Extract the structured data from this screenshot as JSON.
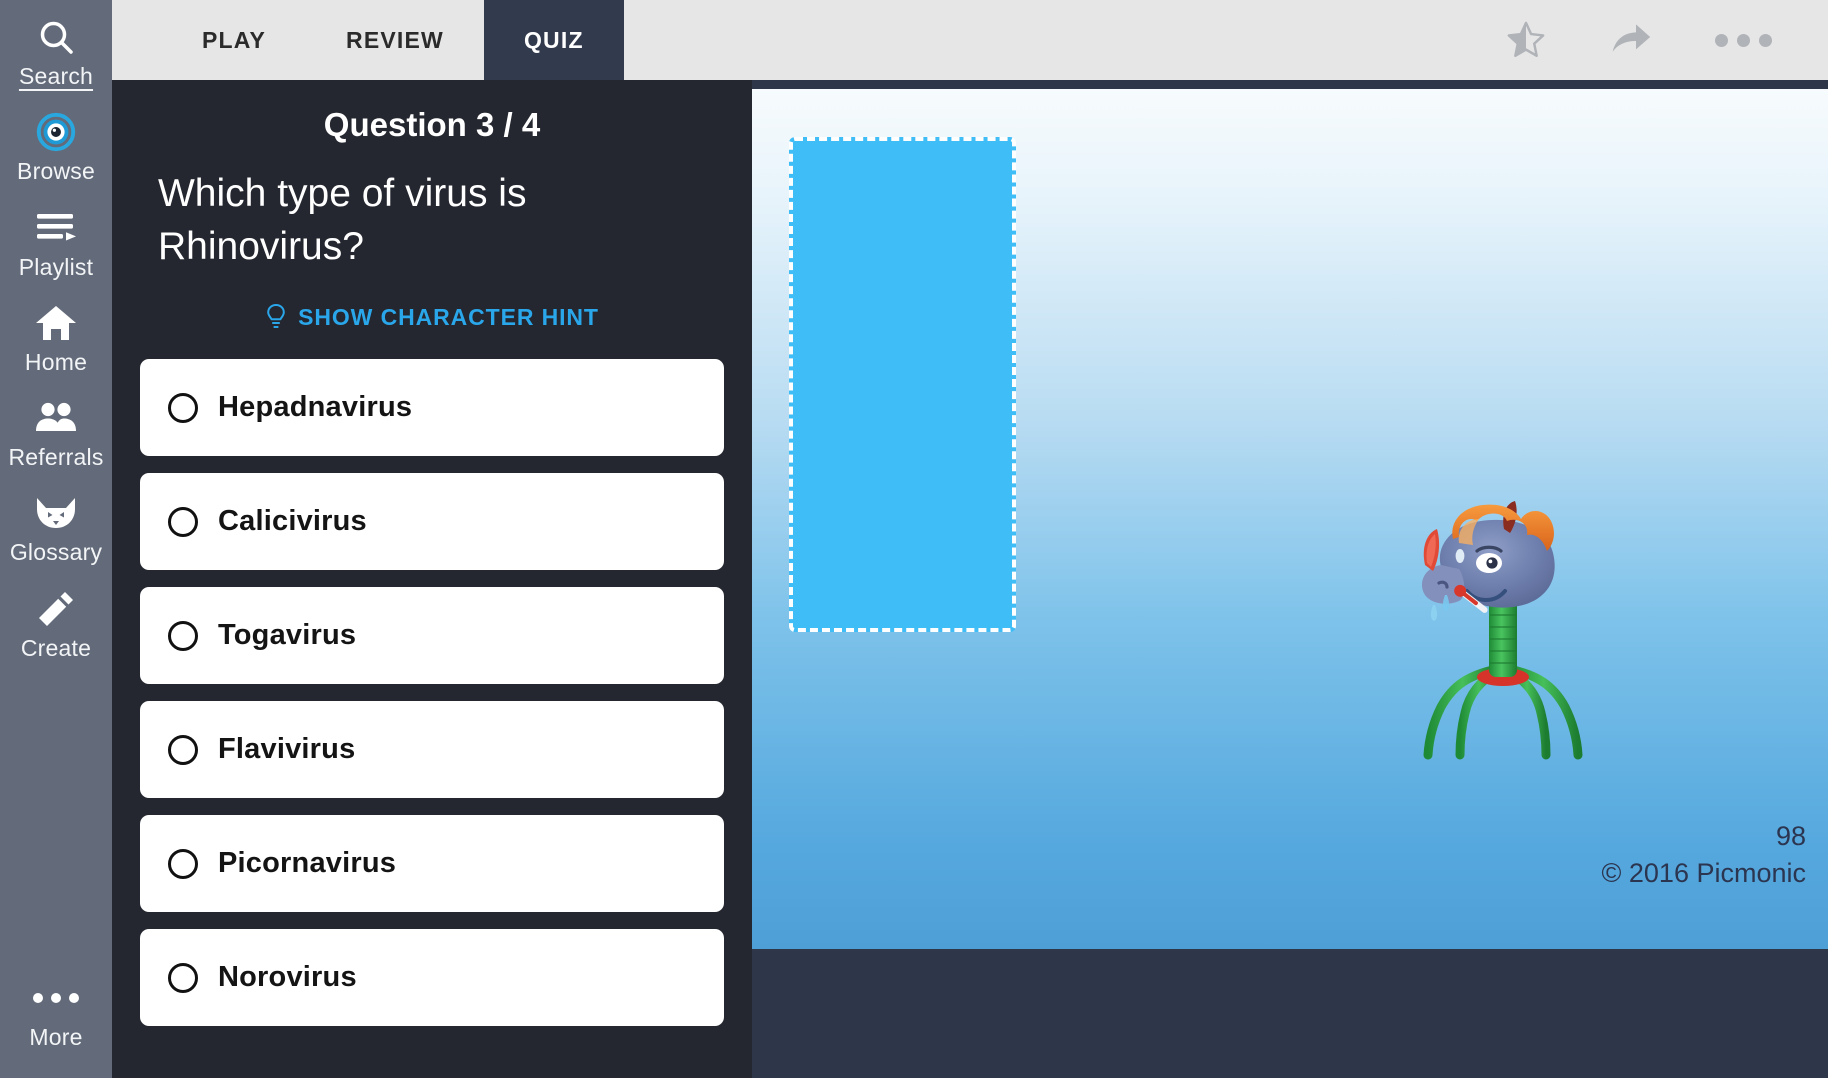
{
  "sidebar": {
    "items": [
      {
        "label": "Search",
        "icon": "search-icon",
        "active": true
      },
      {
        "label": "Browse",
        "icon": "eye-icon",
        "active": false
      },
      {
        "label": "Playlist",
        "icon": "playlist-icon",
        "active": false
      },
      {
        "label": "Home",
        "icon": "home-icon",
        "active": false
      },
      {
        "label": "Referrals",
        "icon": "people-icon",
        "active": false
      },
      {
        "label": "Glossary",
        "icon": "fox-icon",
        "active": false
      },
      {
        "label": "Create",
        "icon": "pencil-icon",
        "active": false
      }
    ],
    "more": {
      "label": "More",
      "icon": "ellipsis-icon"
    },
    "background_color": "#636b7a"
  },
  "topbar": {
    "tabs": [
      {
        "label": "PLAY",
        "active": false
      },
      {
        "label": "REVIEW",
        "active": false
      },
      {
        "label": "QUIZ",
        "active": true
      }
    ],
    "actions": [
      {
        "name": "favorite-star",
        "icon": "star-half-icon"
      },
      {
        "name": "share",
        "icon": "share-arrow-icon"
      },
      {
        "name": "more-options",
        "icon": "ellipsis-icon"
      }
    ],
    "background_color": "#e6e6e6",
    "active_tab_color": "#323a4d"
  },
  "quiz": {
    "counter_prefix": "Question",
    "counter_value": "3 / 4",
    "counter_full": "Question 3 / 4",
    "question": "Which type of virus is Rhinovirus?",
    "hint_button": {
      "label": "SHOW CHARACTER HINT",
      "icon": "lightbulb-icon",
      "color": "#2aa6ea"
    },
    "options": [
      {
        "label": "Hepadnavirus",
        "selected": false
      },
      {
        "label": "Calicivirus",
        "selected": false
      },
      {
        "label": "Togavirus",
        "selected": false
      },
      {
        "label": "Flavivirus",
        "selected": false
      },
      {
        "label": "Picornavirus",
        "selected": false
      },
      {
        "label": "Norovirus",
        "selected": false
      }
    ],
    "background_color": "#24272f"
  },
  "image_panel": {
    "drop_zone": {
      "name": "hint-drop-zone",
      "fill_color": "#3fbdf6",
      "border_style": "dashed white"
    },
    "character": {
      "name": "rhinovirus-mnemonic-character",
      "description": "Rhino-head bacteriophage with orange hair, red horn and thermometer"
    },
    "page_number": "98",
    "copyright": "© 2016 Picmonic",
    "background_color": "#2e364a"
  }
}
